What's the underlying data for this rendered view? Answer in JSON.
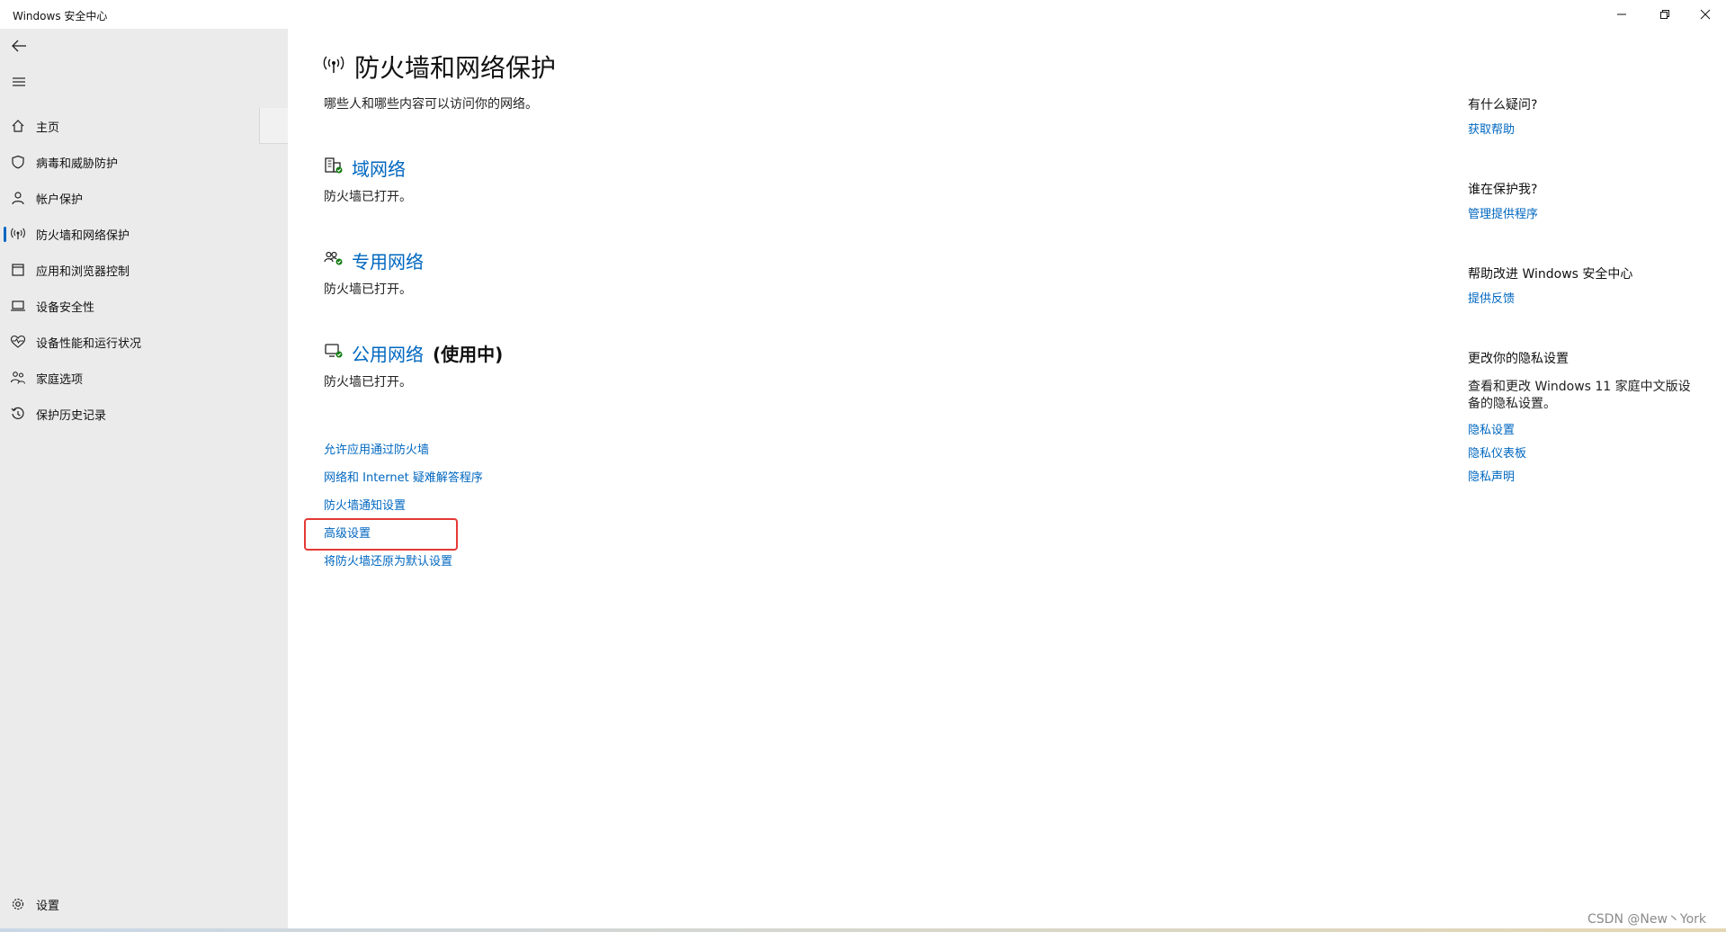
{
  "window": {
    "title": "Windows 安全中心"
  },
  "sidebar": {
    "items": [
      {
        "label": "主页",
        "icon": "home-icon"
      },
      {
        "label": "病毒和威胁防护",
        "icon": "shield-icon"
      },
      {
        "label": "帐户保护",
        "icon": "person-icon"
      },
      {
        "label": "防火墙和网络保护",
        "icon": "antenna-icon",
        "active": true
      },
      {
        "label": "应用和浏览器控制",
        "icon": "app-window-icon"
      },
      {
        "label": "设备安全性",
        "icon": "laptop-icon"
      },
      {
        "label": "设备性能和运行状况",
        "icon": "heart-pulse-icon"
      },
      {
        "label": "家庭选项",
        "icon": "family-icon"
      },
      {
        "label": "保护历史记录",
        "icon": "history-icon"
      }
    ],
    "settings_label": "设置"
  },
  "main": {
    "title": "防火墙和网络保护",
    "subtitle": "哪些人和哪些内容可以访问你的网络。",
    "networks": [
      {
        "name": "域网络",
        "status": "防火墙已打开。",
        "badge": ""
      },
      {
        "name": "专用网络",
        "status": "防火墙已打开。",
        "badge": ""
      },
      {
        "name": "公用网络",
        "status": "防火墙已打开。",
        "badge": "(使用中)"
      }
    ],
    "links": [
      "允许应用通过防火墙",
      "网络和 Internet 疑难解答程序",
      "防火墙通知设置",
      "高级设置",
      "将防火墙还原为默认设置"
    ]
  },
  "aside": {
    "help_q": "有什么疑问?",
    "help_a": "获取帮助",
    "protect_q": "谁在保护我?",
    "protect_a": "管理提供程序",
    "improve_q": "帮助改进 Windows 安全中心",
    "improve_a": "提供反馈",
    "privacy_q": "更改你的隐私设置",
    "privacy_text": "查看和更改 Windows 11 家庭中文版设备的隐私设置。",
    "privacy_links": [
      "隐私设置",
      "隐私仪表板",
      "隐私声明"
    ]
  },
  "watermark": "CSDN @New丶York",
  "colors": {
    "accent": "#0067c0",
    "highlight": "#e53935",
    "sidebar_bg": "#ebebeb"
  }
}
